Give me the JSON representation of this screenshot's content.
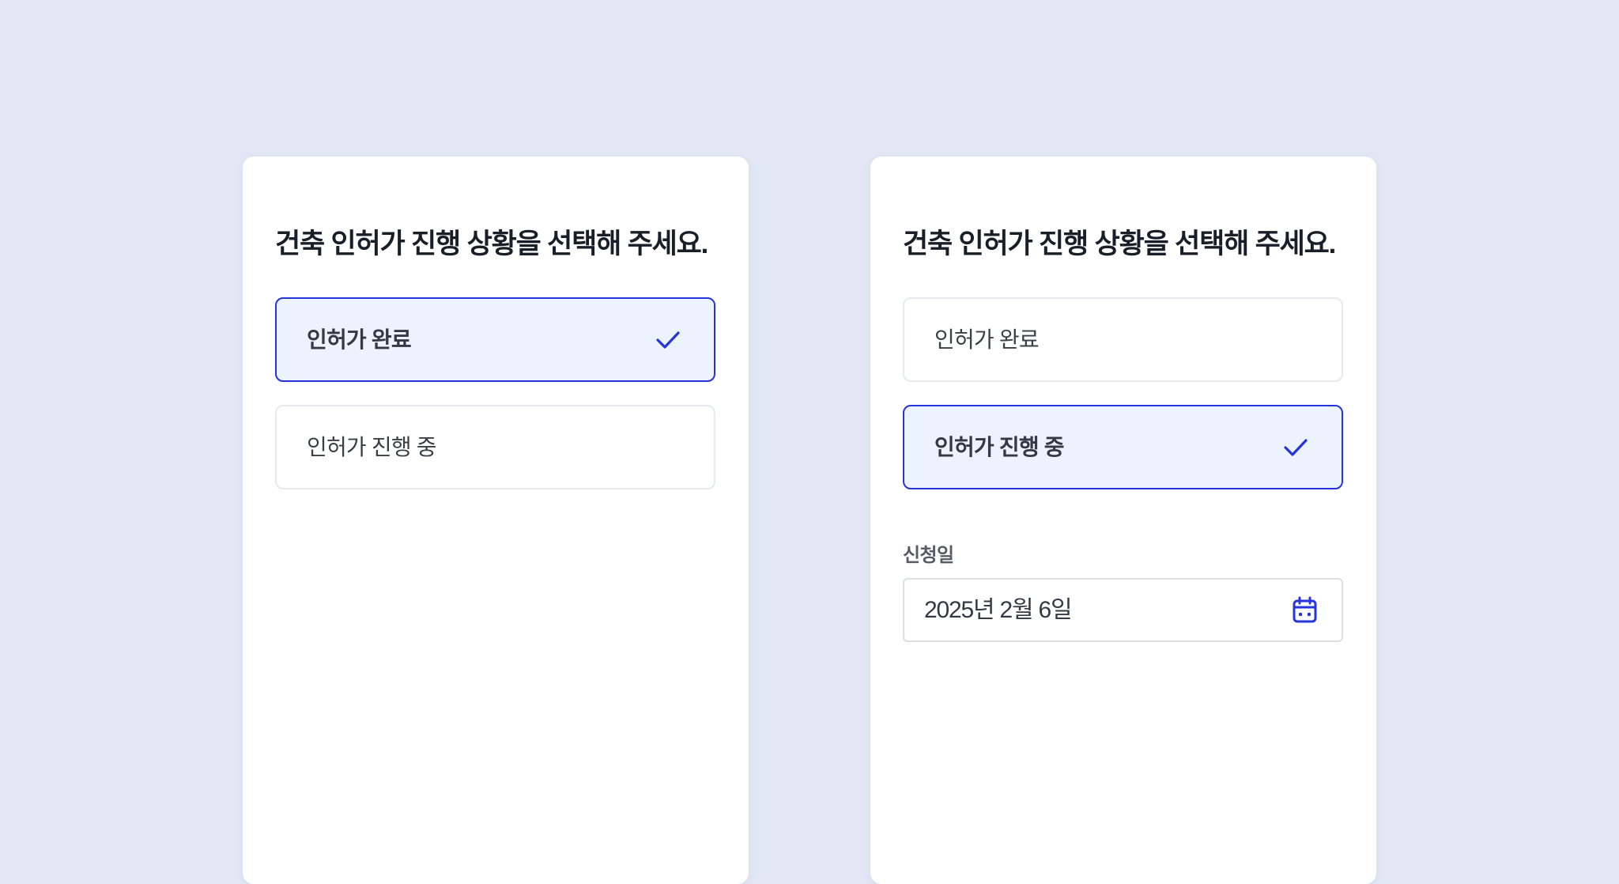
{
  "left_card": {
    "question": "건축 인허가 진행 상황을 선택해 주세요.",
    "options": [
      {
        "label": "인허가 완료",
        "selected": true
      },
      {
        "label": "인허가 진행 중",
        "selected": false
      }
    ]
  },
  "right_card": {
    "question": "건축 인허가 진행 상황을 선택해 주세요.",
    "options": [
      {
        "label": "인허가 완료",
        "selected": false
      },
      {
        "label": "인허가 진행 중",
        "selected": true
      }
    ],
    "date_field": {
      "label": "신청일",
      "value": "2025년 2월 6일",
      "icon": "calendar-icon"
    }
  },
  "colors": {
    "background": "#e1e7f4",
    "accent": "#2733db",
    "selected_fill": "#edf3fd",
    "text_primary": "#191f28"
  }
}
